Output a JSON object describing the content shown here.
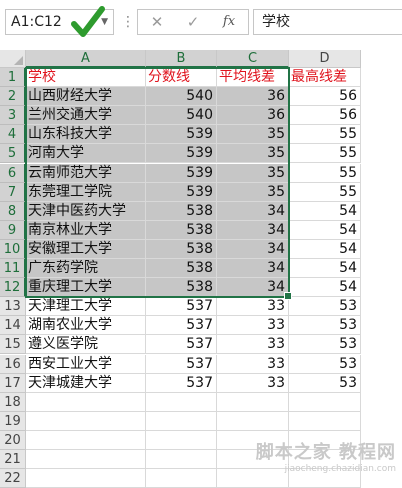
{
  "formula_bar": {
    "name_box": "A1:C12",
    "cancel_glyph": "✕",
    "enter_glyph": "✓",
    "fx_glyph": "fx",
    "formula": "学校"
  },
  "columns": [
    "A",
    "B",
    "C",
    "D"
  ],
  "rows": [
    [
      "学校",
      "分数线",
      "平均线差",
      "最高线差"
    ],
    [
      "山西财经大学",
      "540",
      "36",
      "56"
    ],
    [
      "兰州交通大学",
      "540",
      "36",
      "56"
    ],
    [
      "山东科技大学",
      "539",
      "35",
      "55"
    ],
    [
      "河南大学",
      "539",
      "35",
      "55"
    ],
    [
      "云南师范大学",
      "539",
      "35",
      "55"
    ],
    [
      "东莞理工学院",
      "539",
      "35",
      "55"
    ],
    [
      "天津中医药大学",
      "538",
      "34",
      "54"
    ],
    [
      "南京林业大学",
      "538",
      "34",
      "54"
    ],
    [
      "安徽理工大学",
      "538",
      "34",
      "54"
    ],
    [
      "广东药学院",
      "538",
      "34",
      "54"
    ],
    [
      "重庆理工大学",
      "538",
      "34",
      "54"
    ],
    [
      "天津理工大学",
      "537",
      "33",
      "53"
    ],
    [
      "湖南农业大学",
      "537",
      "33",
      "53"
    ],
    [
      "遵义医学院",
      "537",
      "33",
      "53"
    ],
    [
      "西安工业大学",
      "537",
      "33",
      "53"
    ],
    [
      "天津城建大学",
      "537",
      "33",
      "53"
    ],
    [
      "",
      "",
      "",
      ""
    ],
    [
      "",
      "",
      "",
      ""
    ],
    [
      "",
      "",
      "",
      ""
    ],
    [
      "",
      "",
      "",
      ""
    ],
    [
      "",
      "",
      "",
      ""
    ]
  ],
  "row_numbers": [
    "1",
    "2",
    "3",
    "4",
    "5",
    "6",
    "7",
    "8",
    "9",
    "10",
    "11",
    "12",
    "13",
    "14",
    "15",
    "16",
    "17",
    "18",
    "19",
    "20",
    "21",
    "22"
  ],
  "selection": {
    "label": "A1:C12"
  },
  "watermark": {
    "line1": "脚本之家 教程网",
    "line2": "jiaocheng.chazidian.com"
  },
  "colors": {
    "accent": "#217346",
    "header_text": "#e0141e",
    "selection_fill": "#c6c6c6"
  }
}
